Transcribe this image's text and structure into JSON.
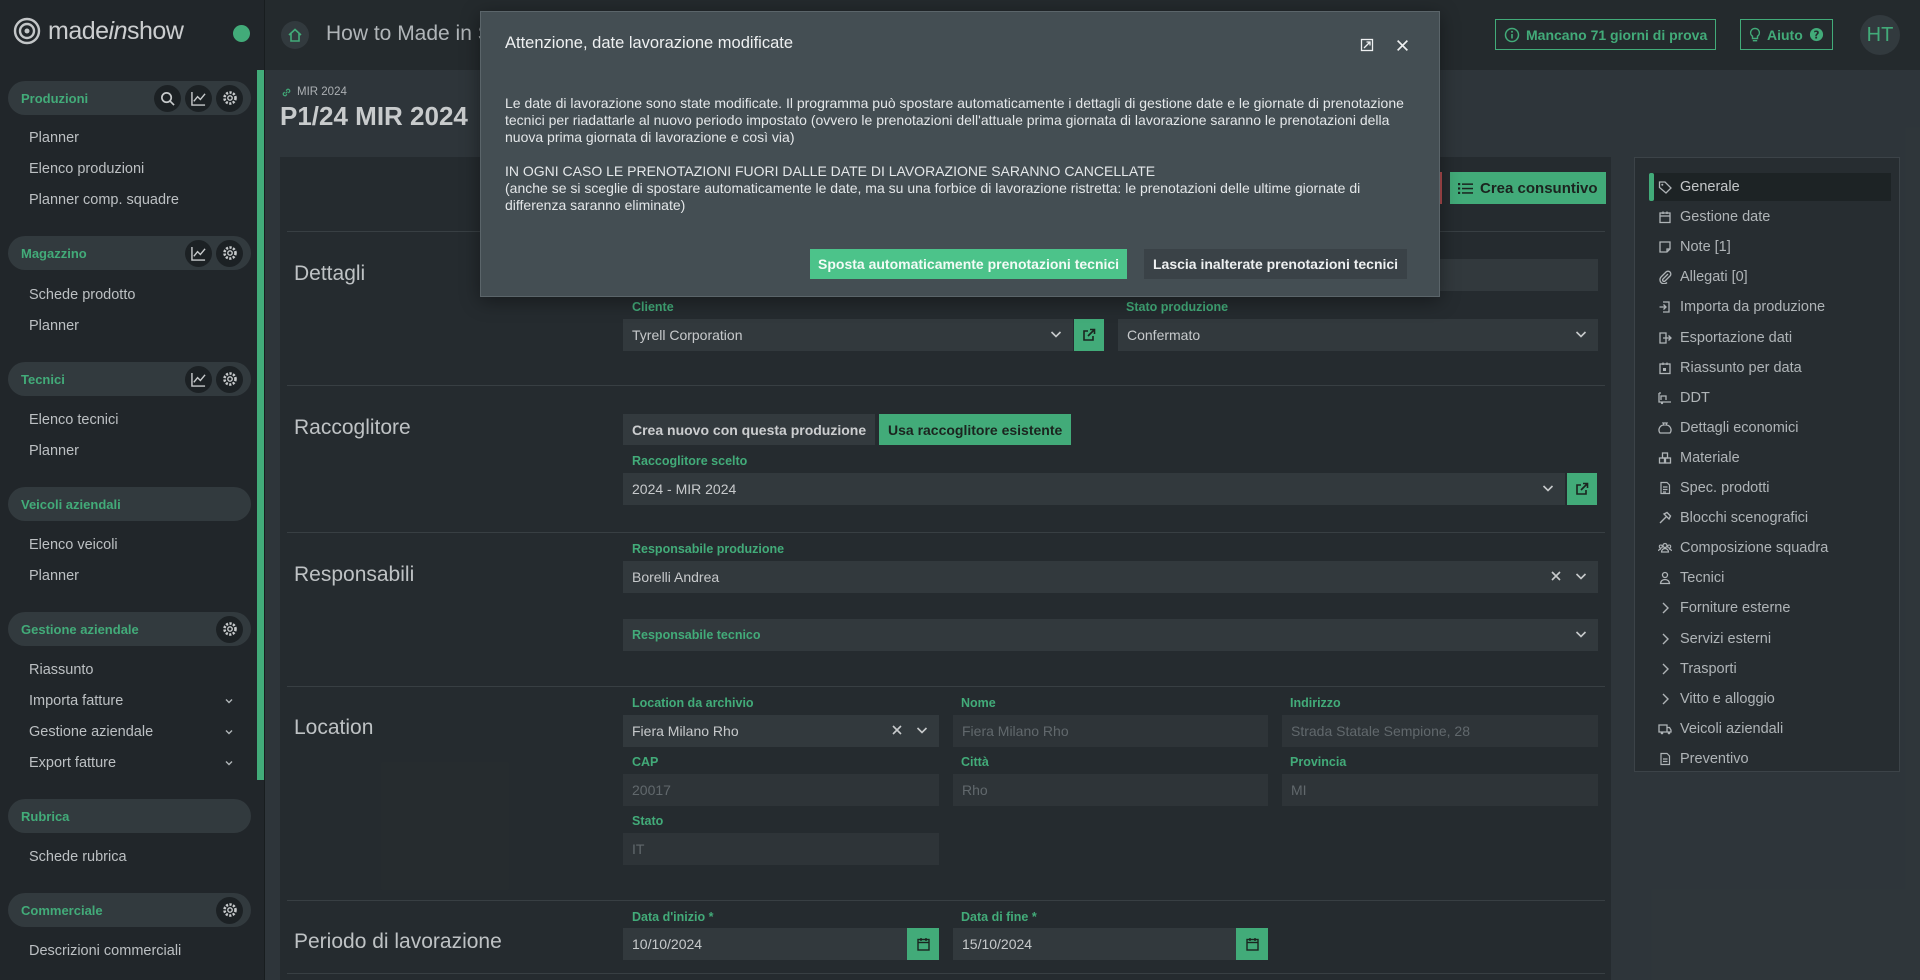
{
  "app": {
    "logo_prefix": "made",
    "logo_italic": "in",
    "logo_suffix": "show",
    "status_color": "#4cc38a"
  },
  "topbar": {
    "title": "How to Made in S",
    "trial": "Mancano 71 giorni di prova",
    "help": "Aiuto",
    "avatar": "HT"
  },
  "sidebar": {
    "sections": [
      {
        "label": "Produzioni",
        "items": [
          "Planner",
          "Elenco produzioni",
          "Planner comp. squadre"
        ]
      },
      {
        "label": "Magazzino",
        "items": [
          "Schede prodotto",
          "Planner"
        ]
      },
      {
        "label": "Tecnici",
        "items": [
          "Elenco tecnici",
          "Planner"
        ]
      },
      {
        "label": "Veicoli aziendali",
        "items": [
          "Elenco veicoli",
          "Planner"
        ]
      },
      {
        "label": "Gestione aziendale",
        "items": [
          "Riassunto",
          "Importa fatture",
          "Gestione aziendale",
          "Export fatture"
        ]
      },
      {
        "label": "Rubrica",
        "items": [
          "Schede rubrica"
        ]
      },
      {
        "label": "Commerciale",
        "items": [
          "Descrizioni commerciali"
        ]
      }
    ]
  },
  "header": {
    "breadcrumb": "MIR 2024",
    "title": "P1/24 MIR 2024",
    "create_button": "Crea consuntivo"
  },
  "dettagli": {
    "title": "Dettagli",
    "cliente_label": "Cliente",
    "cliente_value": "Tyrell Corporation",
    "stato_label": "Stato produzione",
    "stato_value": "Confermato"
  },
  "raccoglitore": {
    "title": "Raccoglitore",
    "btn_new": "Crea nuovo con questa produzione",
    "btn_existing": "Usa raccoglitore esistente",
    "scelto_label": "Raccoglitore scelto",
    "scelto_value": "2024 - MIR 2024"
  },
  "responsabili": {
    "title": "Responsabili",
    "prod_label": "Responsabile produzione",
    "prod_value": "Borelli Andrea",
    "tec_label": "Responsabile tecnico"
  },
  "location": {
    "title": "Location",
    "archivio_label": "Location da archivio",
    "archivio_value": "Fiera Milano Rho",
    "nome_label": "Nome",
    "nome_value": "Fiera Milano Rho",
    "indirizzo_label": "Indirizzo",
    "indirizzo_value": "Strada Statale Sempione, 28",
    "cap_label": "CAP",
    "cap_value": "20017",
    "citta_label": "Città",
    "citta_value": "Rho",
    "provincia_label": "Provincia",
    "provincia_value": "MI",
    "stato_label": "Stato",
    "stato_value": "IT"
  },
  "periodo": {
    "title": "Periodo di lavorazione",
    "inizio_label": "Data d'inizio *",
    "inizio_value": "10/10/2024",
    "fine_label": "Data di fine *",
    "fine_value": "15/10/2024"
  },
  "rightnav": {
    "items": [
      "Generale",
      "Gestione date",
      "Note [1]",
      "Allegati [0]",
      "Importa da produzione",
      "Esportazione dati",
      "Riassunto per data",
      "DDT",
      "Dettagli economici",
      "Materiale",
      "Spec. prodotti",
      "Blocchi scenografici",
      "Composizione squadra",
      "Tecnici",
      "Forniture esterne",
      "Servizi esterni",
      "Trasporti",
      "Vitto e alloggio",
      "Veicoli aziendali",
      "Preventivo"
    ],
    "icons": [
      "tag-icon",
      "calendar-icon",
      "note-icon",
      "paperclip-icon",
      "import-icon",
      "export-icon",
      "calendar-summary-icon",
      "truck-loading-icon",
      "money-bag-icon",
      "boxes-icon",
      "document-icon",
      "hammer-icon",
      "team-icon",
      "person-icon",
      "chevron-right-icon",
      "chevron-right-icon",
      "chevron-right-icon",
      "chevron-right-icon",
      "van-icon",
      "file-invoice-icon"
    ]
  },
  "modal": {
    "title": "Attenzione, date lavorazione modificate",
    "p1": "Le date di lavorazione sono state modificate. Il programma può spostare automaticamente i dettagli di gestione date e le giornate di prenotazione tecnici per riadattarle al nuovo periodo impostato (ovvero le prenotazioni dell'attuale prima giornata di lavorazione saranno le prenotazioni della nuova prima giornata di lavorazione e così via)",
    "p2a": "IN OGNI CASO LE PRENOTAZIONI FUORI DALLE DATE DI LAVORAZIONE SARANNO CANCELLATE",
    "p2b": "(anche se si sceglie di spostare automaticamente le date, ma su una forbice di lavorazione ristretta: le prenotazioni delle ultime giornate di differenza saranno eliminate)",
    "btn_move": "Sposta automaticamente prenotazioni tecnici",
    "btn_keep": "Lascia inalterate prenotazioni tecnici"
  },
  "colors": {
    "accent": "#4cc38a",
    "danger": "#c9575a",
    "background": "#353d42"
  }
}
